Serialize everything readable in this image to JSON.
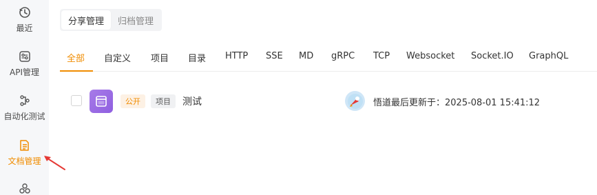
{
  "sidebar": {
    "items": [
      {
        "label": "最近",
        "icon": "clock-icon"
      },
      {
        "label": "API管理",
        "icon": "api-icon"
      },
      {
        "label": "自动化测试",
        "icon": "automation-icon"
      },
      {
        "label": "文档管理",
        "icon": "document-icon",
        "active": true
      },
      {
        "label": "",
        "icon": "apps-icon"
      }
    ]
  },
  "top_tabs": [
    "分享管理",
    "归档管理"
  ],
  "category_tabs": [
    "全部",
    "自定义",
    "项目",
    "目录",
    "HTTP",
    "SSE",
    "MD",
    "gRPC",
    "TCP",
    "Websocket",
    "Socket.IO",
    "GraphQL"
  ],
  "row": {
    "visibility": "公开",
    "type": "项目",
    "title": "测试",
    "updated": "悟道最后更新于：2025-08-01 15:41:12"
  },
  "colors": {
    "accent": "#f08c00",
    "app_icon": "#9b6be6",
    "arrow": "#e53935"
  }
}
